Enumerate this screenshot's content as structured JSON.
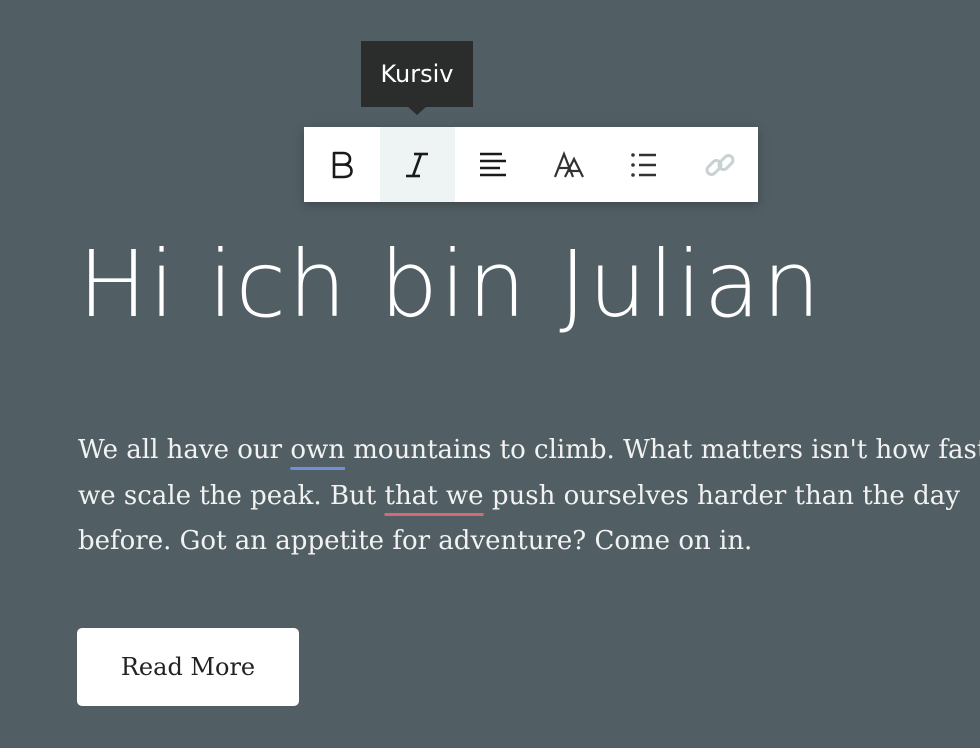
{
  "tooltip": {
    "text": "Kursiv"
  },
  "toolbar": {
    "buttons": [
      {
        "name": "bold",
        "icon": "bold-icon",
        "active": false
      },
      {
        "name": "italic",
        "icon": "italic-icon",
        "active": true
      },
      {
        "name": "align",
        "icon": "align-left-icon",
        "active": false
      },
      {
        "name": "text-style",
        "icon": "font-style-icon",
        "active": false
      },
      {
        "name": "list",
        "icon": "bulleted-list-icon",
        "active": false
      },
      {
        "name": "link",
        "icon": "link-icon",
        "active": false,
        "disabled": true
      }
    ]
  },
  "content": {
    "heading": "Hi ich bin Julian",
    "paragraph": {
      "line1_pre": "We all have our ",
      "line1_ul": "own",
      "line1_post": " mountains to climb. What matters isn't how fast",
      "line2_pre": "we scale the peak. But ",
      "line2_ul": "that we",
      "line2_post": " push ourselves harder than the day",
      "line3": "before. Got an appetite for adventure? Come on in."
    },
    "button_label": "Read More"
  },
  "colors": {
    "background": "#515f64",
    "tooltip_bg": "#2b2d2d",
    "toolbar_active": "#eef3f3",
    "spell_underline_blue": "#6f8fd8",
    "spell_underline_red": "#d46a76"
  }
}
